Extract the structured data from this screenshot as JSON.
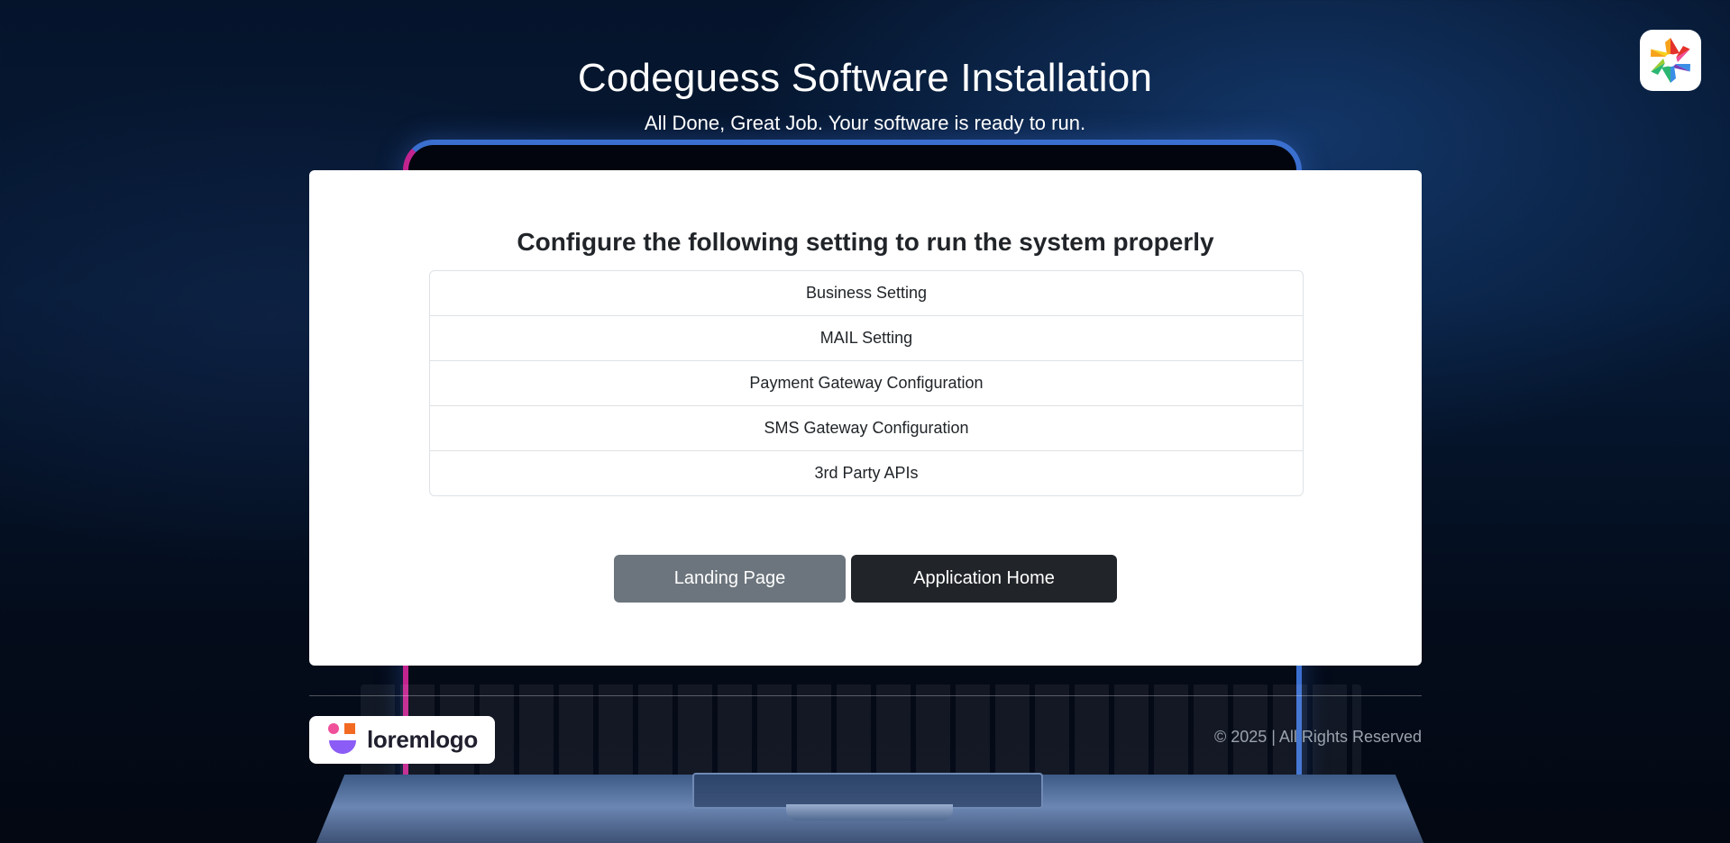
{
  "header": {
    "title": "Codeguess Software Installation",
    "subtitle": "All Done, Great Job. Your software is ready to run."
  },
  "card": {
    "heading": "Configure the following setting to run the system properly",
    "settings": [
      "Business Setting",
      "MAIL Setting",
      "Payment Gateway Configuration",
      "SMS Gateway Configuration",
      "3rd Party APIs"
    ],
    "buttons": {
      "landing_label": "Landing Page",
      "app_label": "Application Home"
    }
  },
  "footer": {
    "logo_text": "loremlogo",
    "copyright": "© 2025 | All Rights Reserved"
  },
  "colors": {
    "landing_button": "#6c757d",
    "app_button": "#212529",
    "card_background": "#ffffff"
  },
  "icons": {
    "corner": "colorful-pinwheel-icon",
    "footer_mark": "loremlogo-mark-icon"
  }
}
